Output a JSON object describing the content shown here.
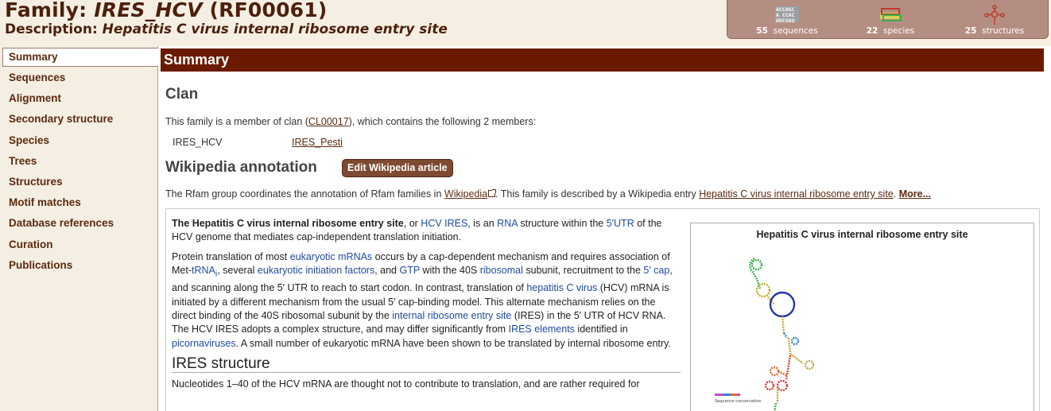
{
  "header": {
    "family_prefix": "Family: ",
    "family_name": "IRES_HCV",
    "family_acc": " (RF00061)",
    "desc_prefix": "Description: ",
    "desc_value": "Hepatitis C virus internal ribosome entry site"
  },
  "stats": [
    {
      "count": "55",
      "label": "sequences",
      "icon": "sequences-icon"
    },
    {
      "count": "22",
      "label": "species",
      "icon": "species-icon"
    },
    {
      "count": "25",
      "label": "structures",
      "icon": "structures-icon"
    }
  ],
  "seq_icon_text": [
    "ACCAGC",
    "A  CCAC",
    "UUCGGU"
  ],
  "sidebar": {
    "items": [
      {
        "label": "Summary"
      },
      {
        "label": "Sequences"
      },
      {
        "label": "Alignment"
      },
      {
        "label": "Secondary structure"
      },
      {
        "label": "Species"
      },
      {
        "label": "Trees"
      },
      {
        "label": "Structures"
      },
      {
        "label": "Motif matches"
      },
      {
        "label": "Database references"
      },
      {
        "label": "Curation"
      },
      {
        "label": "Publications"
      }
    ]
  },
  "main": {
    "summary_heading": "Summary",
    "clan_heading": "Clan",
    "clan_text_before": "This family is a member of clan (",
    "clan_link": "CL00017",
    "clan_text_after": "), which contains the following 2 members:",
    "members": [
      "IRES_HCV",
      "IRES_Pesti"
    ],
    "wiki_heading": "Wikipedia annotation",
    "wiki_button": "Edit Wikipedia article",
    "wiki_intro_1": "The Rfam group coordinates the annotation of Rfam families in ",
    "wiki_intro_link": "Wikipedia",
    "wiki_intro_2": ". This family is described by a Wikipedia entry ",
    "wiki_intro_entry": "Hepatitis C virus internal ribosome entry site",
    "wiki_intro_3": ". ",
    "wiki_more": "More...",
    "infobox_title": "Hepatitis C virus internal ribosome entry site",
    "infobox_legend": "Sequence conservation",
    "ires_structure_heading": "IRES structure",
    "para3": "Nucleotides 1–40 of the HCV mRNA are thought not to contribute to translation, and are rather required for"
  },
  "colors": {
    "brand_dark": "#4d1f0c",
    "summary_bar": "#6b1a00",
    "stats_box": "#b58e83",
    "link_blue": "#1f4ba0",
    "sidebar_bg": "#f4efe2"
  }
}
